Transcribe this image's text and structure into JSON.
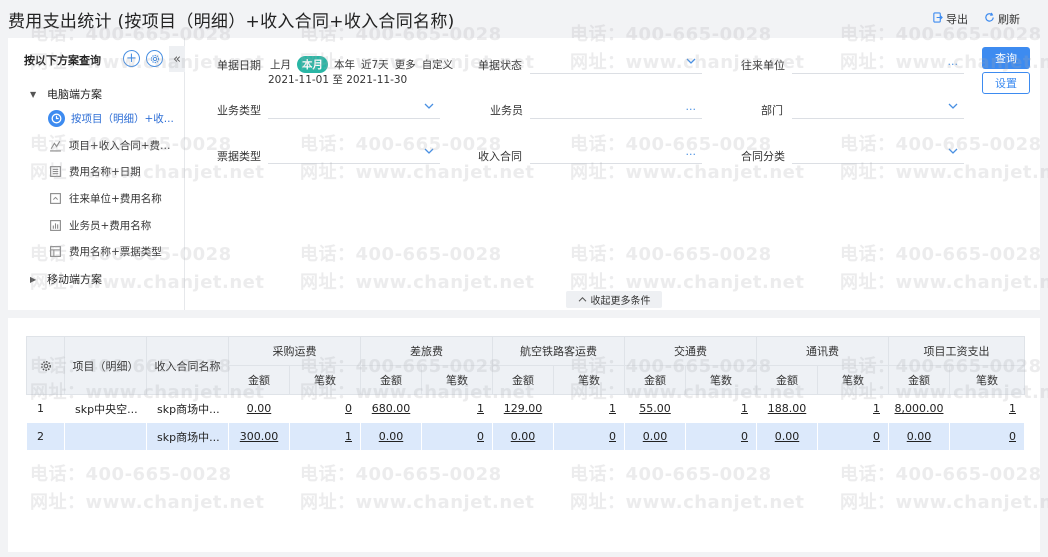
{
  "title": "费用支出统计 (按项目（明细）+收入合同+收入合同名称)",
  "actions": {
    "export": "导出",
    "refresh": "刷新"
  },
  "scheme": {
    "header": "按以下方案查询",
    "add_icon": "plus-icon",
    "settings_icon": "gear-icon",
    "collapse": "«",
    "groups": [
      {
        "label": "电脑端方案"
      },
      {
        "label": "移动端方案"
      }
    ],
    "items": [
      {
        "label": "按项目（明细）+收...",
        "icon": "clock-icon"
      },
      {
        "label": "项目+收入合同+费用...",
        "icon": "chart-icon"
      },
      {
        "label": "费用名称+日期",
        "icon": "list-icon"
      },
      {
        "label": "往来单位+费用名称",
        "icon": "doc-icon"
      },
      {
        "label": "业务员+费用名称",
        "icon": "bar-icon"
      },
      {
        "label": "费用名称+票据类型",
        "icon": "table-icon"
      }
    ]
  },
  "filters": {
    "date_label": "单据日期",
    "date_options": [
      "上月",
      "本月",
      "本年",
      "近7天",
      "更多",
      "自定义"
    ],
    "date_selected": "本月",
    "date_range": "2021-11-01 至 2021-11-30",
    "status_label": "单据状态",
    "partner_label": "往来单位",
    "biz_type_label": "业务类型",
    "salesman_label": "业务员",
    "dept_label": "部门",
    "bill_type_label": "票据类型",
    "contract_label": "收入合同",
    "contract_cat_label": "合同分类",
    "more": "...",
    "query": "查询",
    "settings": "设置",
    "collapse_more": "收起更多条件"
  },
  "table": {
    "col_project": "项目（明细）",
    "col_contract_name": "收入合同名称",
    "groups": [
      "采购运费",
      "差旅费",
      "航空铁路客运费",
      "交通费",
      "通讯费",
      "项目工资支出"
    ],
    "sub_amount": "金额",
    "sub_count": "笔数",
    "rows": [
      {
        "idx": "1",
        "project": "skp中央空...",
        "contract": "skp商场中...",
        "cells": [
          [
            "0.00",
            "0"
          ],
          [
            "680.00",
            "1"
          ],
          [
            "129.00",
            "1"
          ],
          [
            "55.00",
            "1"
          ],
          [
            "188.00",
            "1"
          ],
          [
            "8,000.00",
            "1"
          ]
        ]
      },
      {
        "idx": "2",
        "project": "",
        "contract": "skp商场中...",
        "cells": [
          [
            "300.00",
            "1"
          ],
          [
            "0.00",
            "0"
          ],
          [
            "0.00",
            "0"
          ],
          [
            "0.00",
            "0"
          ],
          [
            "0.00",
            "0"
          ],
          [
            "0.00",
            "0"
          ]
        ]
      }
    ]
  },
  "watermark": {
    "phone": "电话：400-665-0028",
    "site": "网址：www.chanjet.net"
  },
  "colors": {
    "accent": "#3d8bf0",
    "selected_chip": "#29b6a5",
    "selected_row": "#dce9fb"
  }
}
